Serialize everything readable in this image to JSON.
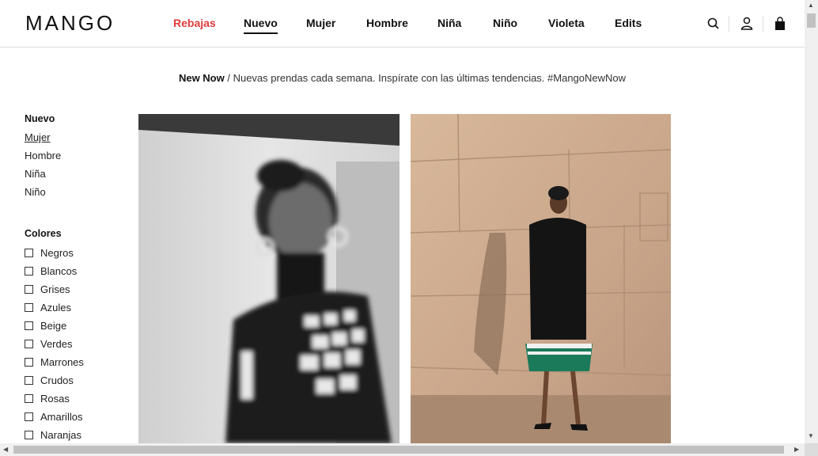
{
  "header": {
    "logo": "MANGO",
    "nav": [
      {
        "label": "Rebajas",
        "key": "rebajas"
      },
      {
        "label": "Nuevo",
        "key": "nuevo"
      },
      {
        "label": "Mujer",
        "key": "mujer"
      },
      {
        "label": "Hombre",
        "key": "hombre"
      },
      {
        "label": "Niña",
        "key": "nina"
      },
      {
        "label": "Niño",
        "key": "nino"
      },
      {
        "label": "Violeta",
        "key": "violeta"
      },
      {
        "label": "Edits",
        "key": "edits"
      }
    ],
    "icons": [
      "search-icon",
      "user-icon",
      "bag-icon"
    ]
  },
  "promo": {
    "bold": "New Now",
    "text": " / Nuevas prendas cada semana. Inspírate con las últimas tendencias. #MangoNewNow"
  },
  "sidebar": {
    "title": "Nuevo",
    "links": [
      "Mujer",
      "Hombre",
      "Niña",
      "Niño"
    ],
    "colors_title": "Colores",
    "colors": [
      "Negros",
      "Blancos",
      "Grises",
      "Azules",
      "Beige",
      "Verdes",
      "Marrones",
      "Crudos",
      "Rosas",
      "Amarillos",
      "Naranjas"
    ]
  },
  "colors": {
    "sale": "#e03c3c",
    "text": "#111111"
  }
}
